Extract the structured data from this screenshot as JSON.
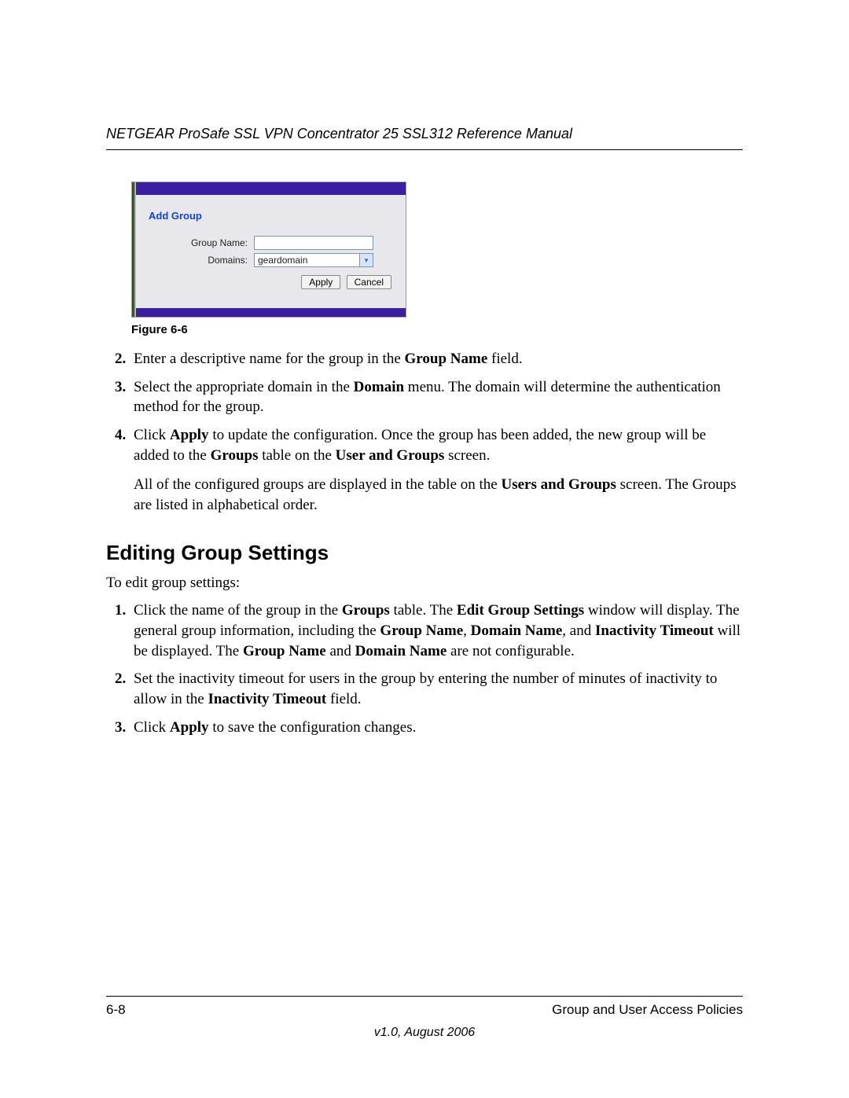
{
  "header": {
    "title": "NETGEAR ProSafe SSL VPN Concentrator 25 SSL312 Reference Manual"
  },
  "figure": {
    "panel_title": "Add Group",
    "labels": {
      "group_name": "Group Name:",
      "domains": "Domains:"
    },
    "fields": {
      "group_name_value": "",
      "domain_selected": "geardomain"
    },
    "buttons": {
      "apply": "Apply",
      "cancel": "Cancel"
    },
    "caption": "Figure 6-6"
  },
  "steps_top": {
    "s2": {
      "num": "2.",
      "pre": "Enter a descriptive name for the group in the ",
      "b1": "Group Name",
      "post": " field."
    },
    "s3": {
      "num": "3.",
      "pre": "Select the appropriate domain in the ",
      "b1": "Domain",
      "post": " menu. The domain will determine the authentication method for the group."
    },
    "s4": {
      "num": "4.",
      "t1": "Click ",
      "b1": "Apply",
      "t2": " to update the configuration. Once the group has been added, the new group will be added to the ",
      "b2": "Groups",
      "t3": " table on the ",
      "b3": "User and Groups",
      "t4": " screen."
    },
    "para": {
      "t1": "All of the configured groups are displayed in the table on the ",
      "b1": "Users and Groups",
      "t2": " screen. The Groups are listed in alphabetical order."
    }
  },
  "section": {
    "heading": "Editing Group Settings",
    "intro": "To edit group settings:"
  },
  "steps_bottom": {
    "s1": {
      "num": "1.",
      "t1": "Click the name of the group in the ",
      "b1": "Groups",
      "t2": " table. The ",
      "b2": "Edit Group Settings",
      "t3": " window will display. The general group information, including the ",
      "b3": "Group Name",
      "t4": ", ",
      "b4": "Domain Name",
      "t5": ", and ",
      "b5": "Inactivity Timeout",
      "t6": " will be displayed. The ",
      "b6": "Group Name",
      "t7": " and ",
      "b7": "Domain Name",
      "t8": " are not configurable."
    },
    "s2": {
      "num": "2.",
      "t1": "Set the inactivity timeout for users in the group by entering the number of minutes of inactivity to allow in the ",
      "b1": "Inactivity Timeout",
      "t2": " field."
    },
    "s3": {
      "num": "3.",
      "t1": "Click ",
      "b1": "Apply",
      "t2": " to save the configuration changes."
    }
  },
  "footer": {
    "left": "6-8",
    "right": "Group and User Access Policies",
    "version": "v1.0, August 2006"
  }
}
